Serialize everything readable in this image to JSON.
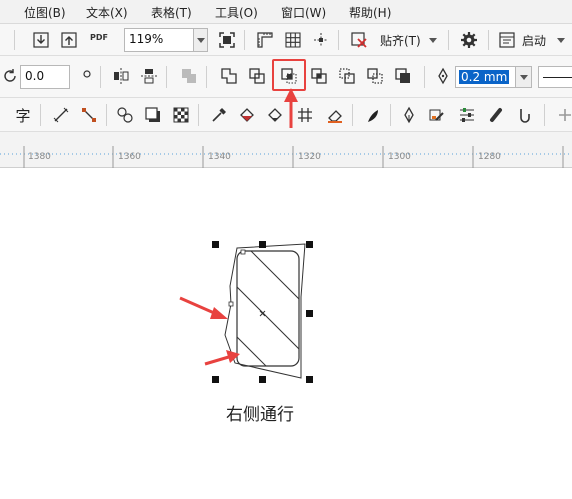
{
  "menu": [
    "位图(B)",
    "文本(X)",
    "表格(T)",
    "工具(O)",
    "窗口(W)",
    "帮助(H)"
  ],
  "toolbar_standard": {
    "pdf_label": "PDF",
    "zoom_value": "119%",
    "align_label": "贴齐(T)",
    "startup_label": "启动"
  },
  "property_bar": {
    "rotation_value": "0.0",
    "outline_width": "0.2 mm"
  },
  "toolbox": {
    "text_tool_label": "字"
  },
  "ruler": {
    "labels": [
      "1380",
      "1360",
      "1340",
      "1320",
      "1300",
      "1280"
    ]
  },
  "canvas": {
    "caption": "右侧通行"
  },
  "colors": {
    "highlight": "#e8423f",
    "selection_text_bg": "#0a64c8"
  },
  "highlighted_tool": "simplify-shape-button"
}
